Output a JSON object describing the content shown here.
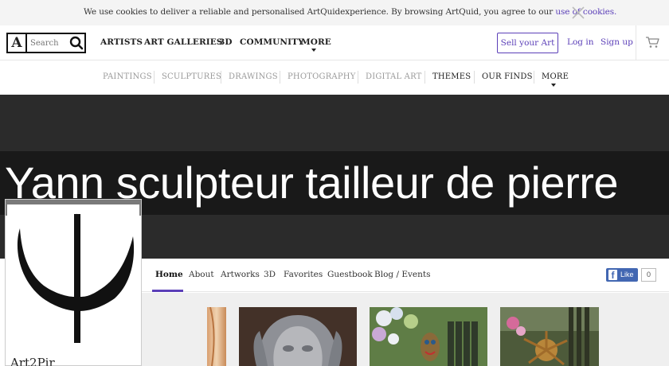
{
  "cookie": {
    "text": "We use cookies to deliver a reliable and personalised ArtQuidexperience. By browsing ArtQuid, you agree to our ",
    "link": "use of cookies."
  },
  "header": {
    "logo": "A",
    "search_placeholder": "Search",
    "nav": [
      "ARTISTS",
      "ART GALLERIES",
      "3D",
      "COMMUNITY",
      "MORE"
    ],
    "sell_label": "Sell your Art",
    "login_label": "Log in",
    "signup_label": "Sign up"
  },
  "categories": [
    "PAINTINGS",
    "SCULPTURES",
    "DRAWINGS",
    "PHOTOGRAPHY",
    "DIGITAL ART",
    "THEMES",
    "OUR FINDS",
    "MORE"
  ],
  "banner": {
    "title": "Yann sculpteur tailleur de pierre"
  },
  "profile": {
    "name": "Art2Pir"
  },
  "tabs": [
    "Home",
    "About",
    "Artworks",
    "3D",
    "Favorites",
    "Guestbook",
    "Blog / Events"
  ],
  "like": {
    "label": "Like",
    "count": "0"
  },
  "colors": {
    "accent": "#5b3fb8",
    "facebook": "#4267b2",
    "banner": "#2b2b2b"
  }
}
